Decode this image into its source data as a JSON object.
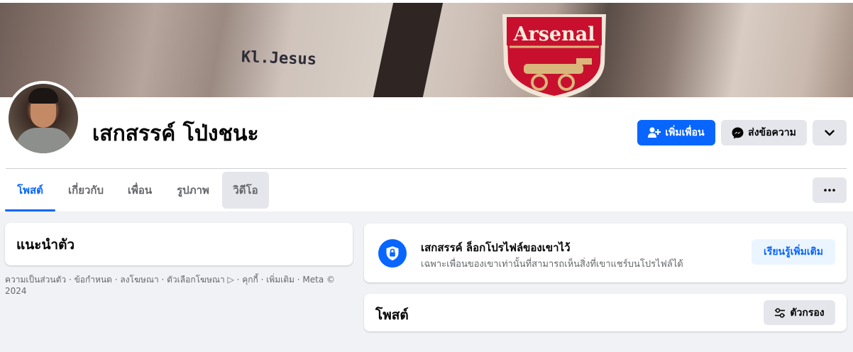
{
  "cover": {
    "shirt_text": "Kl.Jesus",
    "crest_text": "Arsenal"
  },
  "profile": {
    "name": "เสกสรรค์ โป่งชนะ"
  },
  "actions": {
    "add_friend_label": "เพิ่มเพื่อน",
    "message_label": "ส่งข้อความ",
    "add_friend_icon": "person-add-icon",
    "message_icon": "messenger-icon",
    "more_icon": "chevron-down-icon",
    "dots_icon": "more-dots-icon"
  },
  "tabs": [
    {
      "label": "โพสต์",
      "active": true
    },
    {
      "label": "เกี่ยวกับ",
      "active": false
    },
    {
      "label": "เพื่อน",
      "active": false
    },
    {
      "label": "รูปภาพ",
      "active": false
    },
    {
      "label": "วิดีโอ",
      "active": false
    }
  ],
  "intro": {
    "title": "แนะนำตัว"
  },
  "footer": {
    "text": "ความเป็นส่วนตัว · ข้อกำหนด · ลงโฆษณา · ตัวเลือกโฆษณา ▷ · คุกกี้ · เพิ่มเติม · Meta © 2024"
  },
  "lock_notice": {
    "title": "เสกสรรค์ ล็อกโปรไฟล์ของเขาไว้",
    "subtitle": "เฉพาะเพื่อนของเขาเท่านั้นที่สามารถเห็นสิ่งที่เขาแชร์บนโปรไฟล์ได้",
    "learn_more_label": "เรียนรู้เพิ่มเติม",
    "icon": "shield-lock-icon"
  },
  "posts": {
    "title": "โพสต์",
    "filter_label": "ตัวกรอง",
    "filter_icon": "filter-sliders-icon"
  },
  "colors": {
    "accent": "#0866ff",
    "background": "#f0f2f5",
    "secondary_button": "#e4e6eb"
  }
}
